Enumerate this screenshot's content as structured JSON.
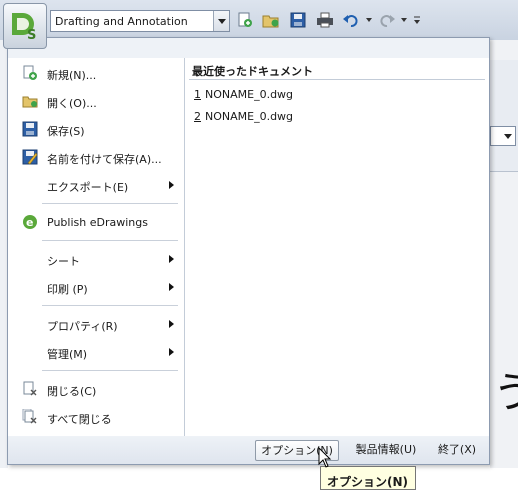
{
  "toolbar": {
    "workspace_value": "Drafting and Annotation",
    "icons": [
      "new-icon",
      "open-icon",
      "save-icon",
      "print-icon",
      "undo-icon",
      "redo-icon",
      "customize-icon"
    ]
  },
  "menu": {
    "items": [
      {
        "label": "新規(N)...",
        "icon": "new-document-icon"
      },
      {
        "label": "開く(O)...",
        "icon": "open-folder-icon"
      },
      {
        "label": "保存(S)",
        "icon": "save-disk-icon"
      },
      {
        "label": "名前を付けて保存(A)...",
        "icon": "save-as-icon"
      },
      {
        "label": "エクスポート(E)",
        "icon": "",
        "submenu": true
      },
      {
        "label": "Publish eDrawings",
        "icon": "edrawings-icon"
      },
      {
        "label": "シート",
        "icon": "",
        "submenu": true
      },
      {
        "label": "印刷 (P)",
        "icon": "",
        "submenu": true
      },
      {
        "label": "プロパティ(R)",
        "icon": "",
        "submenu": true
      },
      {
        "label": "管理(M)",
        "icon": "",
        "submenu": true
      },
      {
        "label": "閉じる(C)",
        "icon": "close-document-icon"
      },
      {
        "label": "すべて閉じる",
        "icon": "close-all-icon"
      }
    ],
    "recent": {
      "heading": "最近使ったドキュメント",
      "files": [
        {
          "num": "1",
          "name": "NONAME_0.dwg"
        },
        {
          "num": "2",
          "name": "NONAME_0.dwg"
        }
      ]
    },
    "footer": {
      "options_label": "オプション(N)",
      "about_label": "製品情報(U)",
      "exit_label": "終了(X)"
    }
  },
  "tooltip": {
    "text": "オプション(N)"
  },
  "background": {
    "glyph": "う"
  },
  "colors": {
    "accent": "#1f5fb0",
    "logo_green": "#5aa83a",
    "menu_bg": "#eef2f7"
  }
}
